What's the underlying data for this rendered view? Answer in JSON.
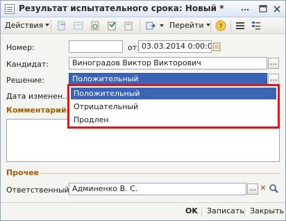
{
  "window": {
    "title": "Результат испытательного срока: Новый *"
  },
  "toolbar": {
    "actions_label": "Действия",
    "goto_label": "Перейти"
  },
  "form": {
    "number_label": "Номер:",
    "number_value": "",
    "from_label": "от:",
    "date_value": "03.03.2014  0:00:00",
    "candidate_label": "Кандидат:",
    "candidate_value": "Виноградов Виктор Викторович",
    "decision_label": "Решение:",
    "decision_value": "Положительный",
    "change_date_label": "Дата изменен...",
    "comment_section": "Комментарий",
    "other_section": "Прочее",
    "responsible_label": "Ответственный:",
    "responsible_value": "Админенко В. С."
  },
  "dropdown": {
    "options": [
      "Положительный",
      "Отрицательный",
      "Продлен"
    ],
    "selected": "Положительный"
  },
  "bottombar": {
    "ok_label": "OK",
    "write_label": "Записать",
    "close_label": "Закрыть"
  },
  "colors": {
    "selection": "#3c64b4",
    "highlight_border": "#e0141c",
    "section_title": "#a05a00"
  }
}
